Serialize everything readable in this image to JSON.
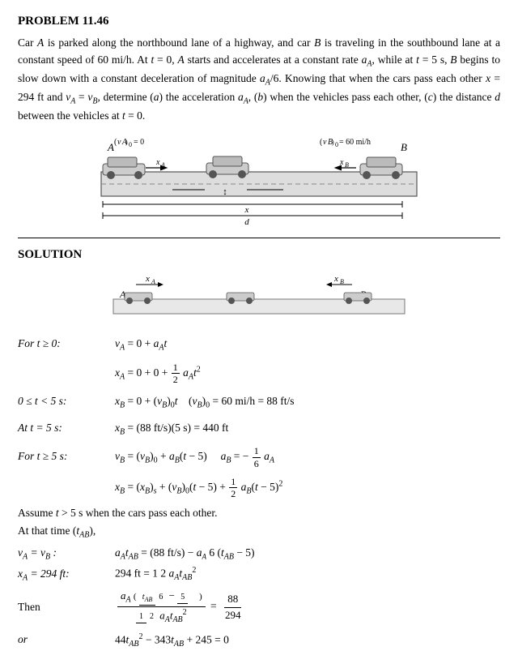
{
  "problem": {
    "title": "PROBLEM 11.46",
    "description": "Car A is parked along the northbound lane of a highway, and car B is traveling in the southbound lane at a constant speed of 60 mi/h. At t = 0, A starts and accelerates at a constant rate a_A, while at t = 5 s, B begins to slow down with a constant deceleration of magnitude a_A/6. Knowing that when the cars pass each other x = 294 ft and v_A = v_B, determine (a) the acceleration a_A, (b) when the vehicles pass each other, (c) the distance d between the vehicles at t = 0.",
    "solution_title": "SOLUTION"
  },
  "equations": {
    "for_t_ge_0_label": "For t ≥ 0:",
    "for_0_lt_5_label": "0 ≤ t < 5 s:",
    "at_t5_label": "At t = 5 s:",
    "for_t_ge_5_label": "For t ≥ 5 s:",
    "assume_text": "Assume t > 5 s when the cars pass each other.",
    "at_time_text": "At that time (t_AB),",
    "va_vb_label": "v_A = v_B :",
    "xa_294_label": "x_A = 294 ft:",
    "then_label": "Then",
    "or_label": "or"
  }
}
